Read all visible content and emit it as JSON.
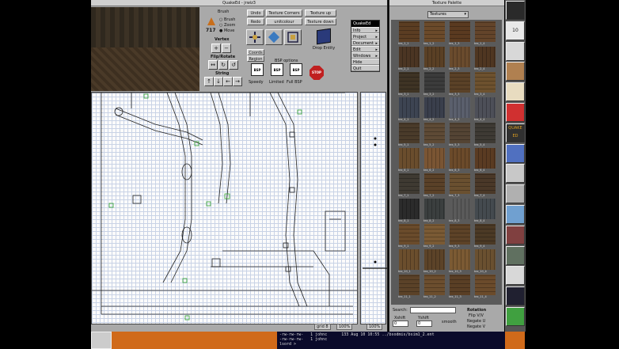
{
  "main_window": {
    "title": "QuakeEd - jrwiz3",
    "brush_label": "Brush",
    "brush_count": "717",
    "radio_options": [
      "Brush",
      "Zoom",
      "Move"
    ],
    "vertex_label": "Vertex",
    "flip_rotate_label": "Flip/Rotate",
    "string_label": "String",
    "buttons": {
      "undo": "Undo",
      "redo": "Redo",
      "texture_corners": "Texture Corners",
      "unitcolour": "unitcolour",
      "texture_up": "Texture up",
      "texture_down": "Texture down"
    },
    "drop_entity": "Drop Entity",
    "coords": "Coords",
    "region": "Region",
    "bsp_options_label": "BSP options",
    "bsp_buttons": [
      "Speedy",
      "Limited",
      "Full BSP"
    ],
    "stop_label": "STOP",
    "menu": {
      "title": "QuakeEd",
      "items": [
        "Info",
        "Project",
        "Document",
        "Edit",
        "Windows",
        "Hide",
        "Quit"
      ]
    },
    "status_grid": "grid 8",
    "status_zoom": "100%",
    "status_zoom_z": "100%"
  },
  "texture_palette": {
    "title": "Texture Palette",
    "dropdown_value": "Textures",
    "search_label": "Search:",
    "xshift_label": "Xshift",
    "yshift_label": "Yshift",
    "xshift_value": "0",
    "yshift_value": "0",
    "smooth_label": "smooth",
    "rotation_label": "Rotation",
    "flip_label": "Flip V/V",
    "negate_u_label": "Negate U",
    "negate_v_label": "Negate V",
    "textures": [
      {
        "name": "tex_1_1",
        "color": "#5b3d22"
      },
      {
        "name": "tex_1_2",
        "color": "#6b4a2a"
      },
      {
        "name": "tex_1_3",
        "color": "#5a3a20"
      },
      {
        "name": "tex_1_4",
        "color": "#63442a"
      },
      {
        "name": "tex_2_1",
        "color": "#4b3523"
      },
      {
        "name": "tex_2_2",
        "color": "#5a4025"
      },
      {
        "name": "tex_2_3",
        "color": "#6a4b2d"
      },
      {
        "name": "tex_2_4",
        "color": "#4f3621"
      },
      {
        "name": "tex_3_1",
        "color": "#3e3324"
      },
      {
        "name": "tex_3_2",
        "color": "#3b3b3b"
      },
      {
        "name": "tex_3_3",
        "color": "#5a4127"
      },
      {
        "name": "tex_3_4",
        "color": "#6d512e"
      },
      {
        "name": "tex_4_1",
        "color": "#3d4452"
      },
      {
        "name": "tex_4_2",
        "color": "#3a3f4c"
      },
      {
        "name": "tex_4_3",
        "color": "#5a5f6c"
      },
      {
        "name": "tex_4_4",
        "color": "#4d4f58"
      },
      {
        "name": "tex_5_1",
        "color": "#4a3b2a"
      },
      {
        "name": "tex_5_2",
        "color": "#5e4a35"
      },
      {
        "name": "tex_5_3",
        "color": "#544434"
      },
      {
        "name": "tex_5_4",
        "color": "#3e3a34"
      },
      {
        "name": "tex_6_1",
        "color": "#6a4d2d"
      },
      {
        "name": "tex_6_2",
        "color": "#7a5533"
      },
      {
        "name": "tex_6_3",
        "color": "#6b4a2a"
      },
      {
        "name": "tex_6_4",
        "color": "#5a3b22"
      },
      {
        "name": "tex_7_1",
        "color": "#3f3a32"
      },
      {
        "name": "tex_7_2",
        "color": "#5a4128"
      },
      {
        "name": "tex_7_3",
        "color": "#6a5030"
      },
      {
        "name": "tex_7_4",
        "color": "#4a3828"
      },
      {
        "name": "tex_8_1",
        "color": "#2b2b2b"
      },
      {
        "name": "tex_8_2",
        "color": "#3b3f3f"
      },
      {
        "name": "tex_8_3",
        "color": "#5a5a5a"
      },
      {
        "name": "tex_8_4",
        "color": "#444a4f"
      },
      {
        "name": "tex_9_1",
        "color": "#6a4b2b"
      },
      {
        "name": "tex_9_2",
        "color": "#7a5a34"
      },
      {
        "name": "tex_9_3",
        "color": "#5d4227"
      },
      {
        "name": "tex_9_4",
        "color": "#4b3925"
      },
      {
        "name": "tex_10_1",
        "color": "#6b4e2d"
      },
      {
        "name": "tex_10_2",
        "color": "#5c4328"
      },
      {
        "name": "tex_10_3",
        "color": "#7b5a33"
      },
      {
        "name": "tex_10_4",
        "color": "#6a5030"
      },
      {
        "name": "tex_11_1",
        "color": "#5b4228"
      },
      {
        "name": "tex_11_2",
        "color": "#6c4e2e"
      },
      {
        "name": "tex_11_3",
        "color": "#5a3f25"
      },
      {
        "name": "tex_11_4",
        "color": "#6b4b2b"
      }
    ]
  },
  "terminal": {
    "lines": [
      "-rw-rw-rw-   1 johnc      133 Aug 10 10:55 ../bsodmis/bsim1_2.ent",
      "-rw-rw-rw-   1 johnc",
      "lsord >"
    ]
  },
  "dock": {
    "icons": [
      "nextstep-cube-icon",
      "calendar-icon",
      "printer-icon",
      "books-icon",
      "edit-icon",
      "no-entry-icon",
      "quake-icon",
      "terminal-icon",
      "monitor-icon",
      "magnifier-icon",
      "preview-icon",
      "game-icon",
      "disk-icon",
      "note-icon",
      "space-icon",
      "recycler-icon"
    ],
    "calendar_number": "10",
    "quake_text": "QUAKE ED"
  }
}
